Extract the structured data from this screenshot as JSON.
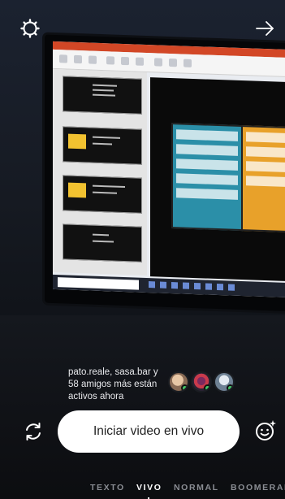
{
  "header": {
    "settings_icon": "gear-icon",
    "forward_icon": "arrow-right-icon"
  },
  "friends": {
    "text": "pato.reale, sasa.bar y 58 amigos más están activos ahora",
    "avatars": [
      "avatar-1",
      "avatar-2",
      "avatar-3"
    ]
  },
  "controls": {
    "live_button_label": "Iniciar video en vivo",
    "flip_icon": "camera-flip-icon",
    "effects_icon": "face-effects-icon"
  },
  "modes": {
    "items": [
      {
        "label": "TEXTO",
        "active": false
      },
      {
        "label": "VIVO",
        "active": true
      },
      {
        "label": "NORMAL",
        "active": false
      },
      {
        "label": "BOOMERAN",
        "active": false
      }
    ]
  },
  "colors": {
    "accent_live_button": "#ffffff",
    "online_dot": "#44c767",
    "inactive_mode": "#8a8d93"
  }
}
